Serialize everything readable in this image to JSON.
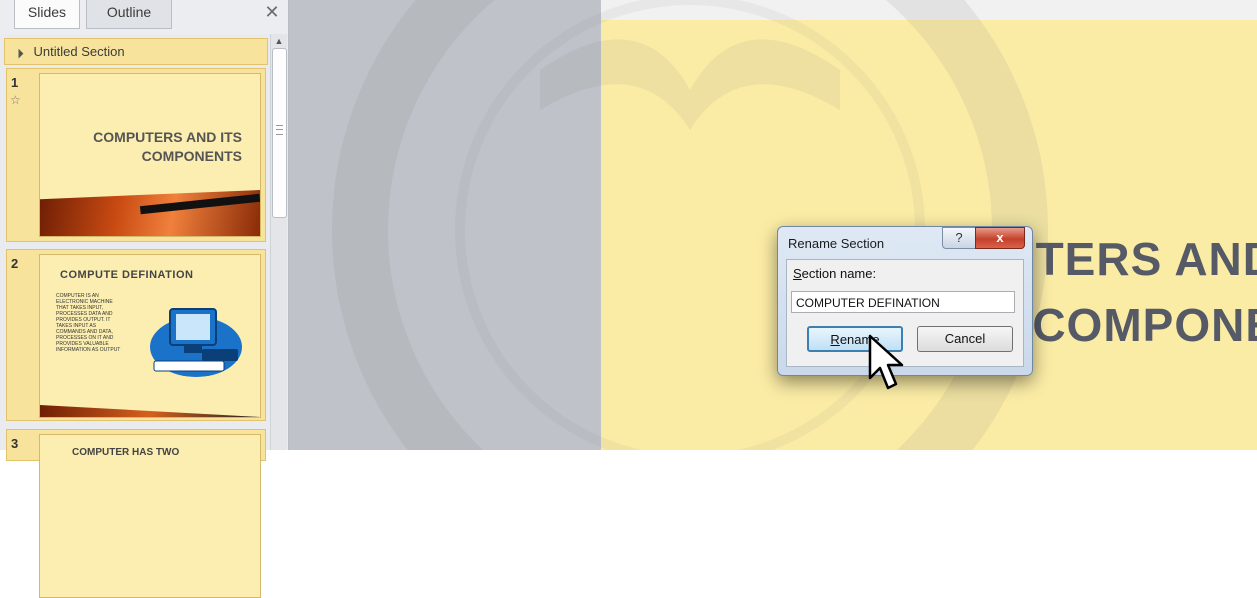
{
  "panel": {
    "tabs": [
      {
        "label": "Slides"
      },
      {
        "label": "Outline"
      }
    ],
    "close_glyph": "✕",
    "section_label": "Untitled Section"
  },
  "slides": [
    {
      "number": "1",
      "title_line1": "COMPUTERS AND ITS",
      "title_line2": "COMPONENTS"
    },
    {
      "number": "2",
      "title": "COMPUTE  DEFINATION",
      "body": "COMPUTER IS AN ELECTRONIC MACHINE THAT TAKES INPUT, PROCESSES DATA AND PROVIDES OUTPUT. IT TAKES INPUT AS COMMANDS AND DATA, PROCESSES ON IT AND PROVIDES VALUABLE INFORMATION AS OUTPUT"
    },
    {
      "number": "3",
      "title": "COMPUTER HAS TWO"
    }
  ],
  "main_slide": {
    "title_line1": "COMPUTERS AND",
    "title_line2": "COMPONE"
  },
  "dialog": {
    "title": "Rename Section",
    "help_glyph": "?",
    "close_glyph": "x",
    "field_label_prefix": "S",
    "field_label_rest": "ection name:",
    "field_value": "COMPUTER DEFINATION",
    "rename_prefix": "R",
    "rename_rest": "ename",
    "cancel_label": "Cancel"
  },
  "colors": {
    "accent": "#f7e39b",
    "slide_bg": "#fbeca5",
    "title_gray": "#555a66"
  }
}
